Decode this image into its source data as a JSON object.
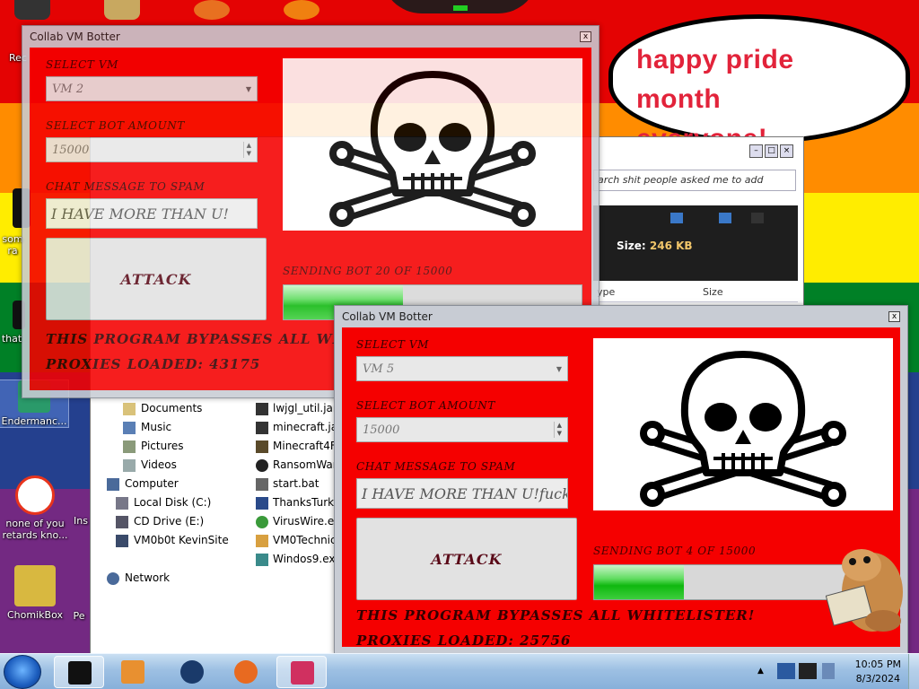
{
  "desktop": {
    "icons": [
      {
        "label": "Rec"
      },
      {
        "label": "som ra"
      },
      {
        "label": "that"
      },
      {
        "label": "Endermanc..."
      },
      {
        "label": "none of you retards kno..."
      },
      {
        "label": "Ins"
      },
      {
        "label": "ChomikBox"
      },
      {
        "label": "Pe"
      }
    ],
    "bubble_text": [
      "happy pride month",
      "everyone!"
    ]
  },
  "explorer": {
    "search_placeholder": "arch shit people asked me to add",
    "size_label": "Size:",
    "size_value": "246 KB",
    "col_type": "ype",
    "col_size": "Size",
    "nav_items": [
      "Documents",
      "Music",
      "Pictures",
      "Videos",
      "Computer",
      "Local Disk (C:)",
      "CD Drive (E:)",
      "VM0b0t KevinSite",
      "Network"
    ],
    "files": [
      "lwjgl_util.jar",
      "minecraft.jar",
      "Minecraft4Fr",
      "RansomWare",
      "start.bat",
      "ThanksTurke",
      "VirusWire.exe",
      "VM0Technic",
      "Windos9.exe"
    ]
  },
  "botters": [
    {
      "title": "Collab VM Botter",
      "close": "x",
      "select_vm_label": "SELECT VM",
      "select_vm_value": "VM 2",
      "bot_amount_label": "SELECT BOT AMOUNT",
      "bot_amount_value": "15000",
      "chat_label": "CHAT MESSAGE TO SPAM",
      "chat_value": "I HAVE MORE THAN U!",
      "attack_label": "ATTACK",
      "sending_text": "SENDING BOT 20 OF 15000",
      "progress": 0.4,
      "bypass_text": "THIS PROGRAM BYPASSES ALL WHITE",
      "proxies_text": "PROXIES LOADED: 43175"
    },
    {
      "title": "Collab VM Botter",
      "close": "x",
      "select_vm_label": "SELECT VM",
      "select_vm_value": "VM 5",
      "bot_amount_label": "SELECT BOT AMOUNT",
      "bot_amount_value": "15000",
      "chat_label": "CHAT MESSAGE TO SPAM",
      "chat_value": "I HAVE MORE THAN U!fuck",
      "attack_label": "ATTACK",
      "sending_text": "SENDING BOT 4 OF 15000",
      "progress": 0.3,
      "bypass_text": "THIS PROGRAM BYPASSES ALL WHITELISTER!",
      "proxies_text": "PROXIES LOADED: 25756"
    }
  ],
  "taskbar": {
    "time": "10:05 PM",
    "date": "8/3/2024"
  }
}
